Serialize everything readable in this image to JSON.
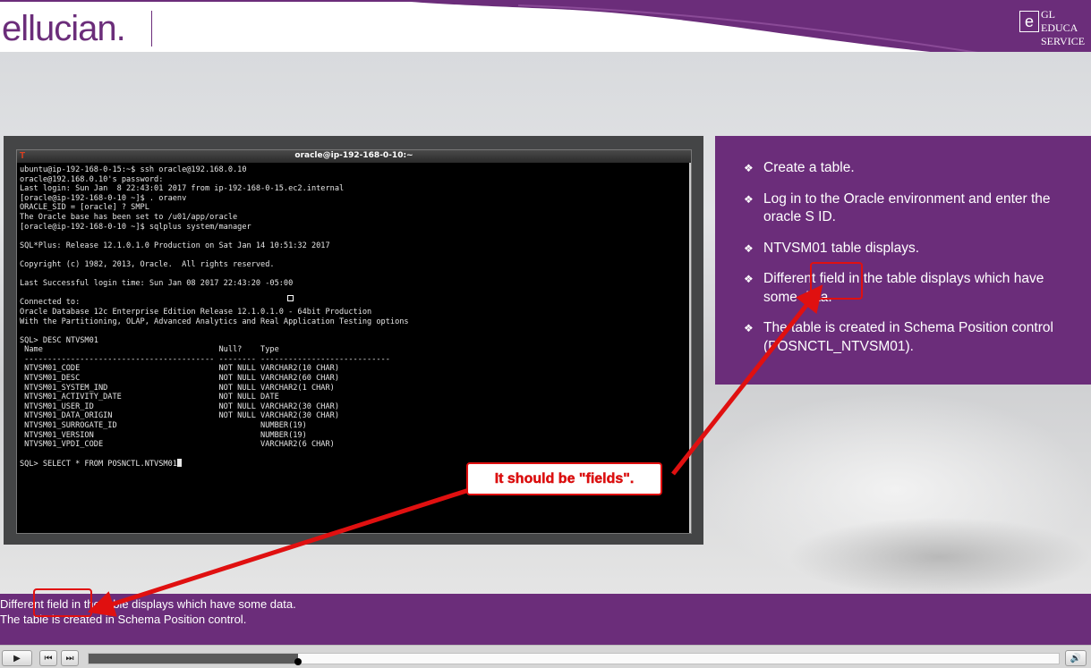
{
  "header": {
    "brand": "ellucian.",
    "badge_letter": "e",
    "badge_lines": [
      "GL",
      "EDUCA",
      "SERVICE"
    ]
  },
  "terminal": {
    "title": "oracle@ip-192-168-0-10:~",
    "lines": [
      "ubuntu@ip-192-168-0-15:~$ ssh oracle@192.168.0.10",
      "oracle@192.168.0.10's password:",
      "Last login: Sun Jan  8 22:43:01 2017 from ip-192-168-0-15.ec2.internal",
      "[oracle@ip-192-168-0-10 ~]$ . oraenv",
      "ORACLE_SID = [oracle] ? SMPL",
      "The Oracle base has been set to /u01/app/oracle",
      "[oracle@ip-192-168-0-10 ~]$ sqlplus system/manager",
      "",
      "SQL*Plus: Release 12.1.0.1.0 Production on Sat Jan 14 10:51:32 2017",
      "",
      "Copyright (c) 1982, 2013, Oracle.  All rights reserved.",
      "",
      "Last Successful login time: Sun Jan 08 2017 22:43:20 -05:00",
      "",
      "Connected to:",
      "Oracle Database 12c Enterprise Edition Release 12.1.0.1.0 - 64bit Production",
      "With the Partitioning, OLAP, Advanced Analytics and Real Application Testing options",
      "",
      "SQL> DESC NTVSM01",
      " Name                                      Null?    Type",
      " ----------------------------------------- -------- ----------------------------",
      " NTVSM01_CODE                              NOT NULL VARCHAR2(10 CHAR)",
      " NTVSM01_DESC                              NOT NULL VARCHAR2(60 CHAR)",
      " NTVSM01_SYSTEM_IND                        NOT NULL VARCHAR2(1 CHAR)",
      " NTVSM01_ACTIVITY_DATE                     NOT NULL DATE",
      " NTVSM01_USER_ID                           NOT NULL VARCHAR2(30 CHAR)",
      " NTVSM01_DATA_ORIGIN                       NOT NULL VARCHAR2(30 CHAR)",
      " NTVSM01_SURROGATE_ID                               NUMBER(19)",
      " NTVSM01_VERSION                                    NUMBER(19)",
      " NTVSM01_VPDI_CODE                                  VARCHAR2(6 CHAR)",
      ""
    ],
    "prompt_line": "SQL> SELECT * FROM POSNCTL.NTVSM01"
  },
  "notes": {
    "bullet_glyph": "❖",
    "items": [
      "Create a table.",
      "Log in to the Oracle environment and enter the oracle S ID.",
      "NTVSM01 table displays.",
      "Different field in the table displays which have some data.",
      "The table is created in Schema Position control (POSNCTL_NTVSM01)."
    ]
  },
  "caption": {
    "line1": "Different field in the table displays which have some data.",
    "line2": "The table is created in Schema Position control."
  },
  "annotation": {
    "callout_text": "It should be \"fields\"."
  },
  "player": {
    "play_icon": "▶",
    "prev_icon": "⏮",
    "next_icon": "⏭",
    "volume_icon": "🔊",
    "progress_fraction": 0.216
  },
  "colors": {
    "brand_purple": "#6b2d7a",
    "annotation_red": "#e01010"
  }
}
